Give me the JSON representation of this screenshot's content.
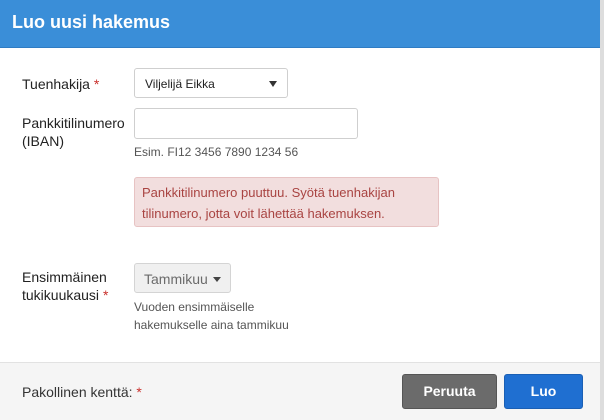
{
  "dialog": {
    "title": "Luo uusi hakemus"
  },
  "form": {
    "applicant": {
      "label": "Tuenhakija",
      "required_mark": "*",
      "selected": "Viljelijä Eikka"
    },
    "iban": {
      "label_line1": "Pankkitilinumero",
      "label_line2": "(IBAN)",
      "value": "",
      "placeholder": "",
      "hint": "Esim. FI12 3456 7890 1234 56"
    },
    "alert": {
      "line1": "Pankkitilinumero puuttuu. Syötä tuenhakijan",
      "line2": "tilinumero, jotta voit lähettää hakemuksen."
    },
    "first_month": {
      "label_line1": "Ensimmäinen",
      "label_line2": "tukikuukausi",
      "required_mark": "*",
      "selected": "Tammikuu",
      "hint_line1": "Vuoden ensimmäiselle",
      "hint_line2": "hakemukselle aina tammikuu"
    }
  },
  "footer": {
    "required_label": "Pakollinen kenttä:",
    "required_mark": "*",
    "cancel_label": "Peruuta",
    "create_label": "Luo"
  },
  "colors": {
    "header": "#3a8ed8",
    "required": "#c9302c",
    "alert_bg": "#f2dede",
    "alert_text": "#a94442",
    "cancel_btn": "#6b6b6b",
    "create_btn": "#1f6fd1"
  }
}
